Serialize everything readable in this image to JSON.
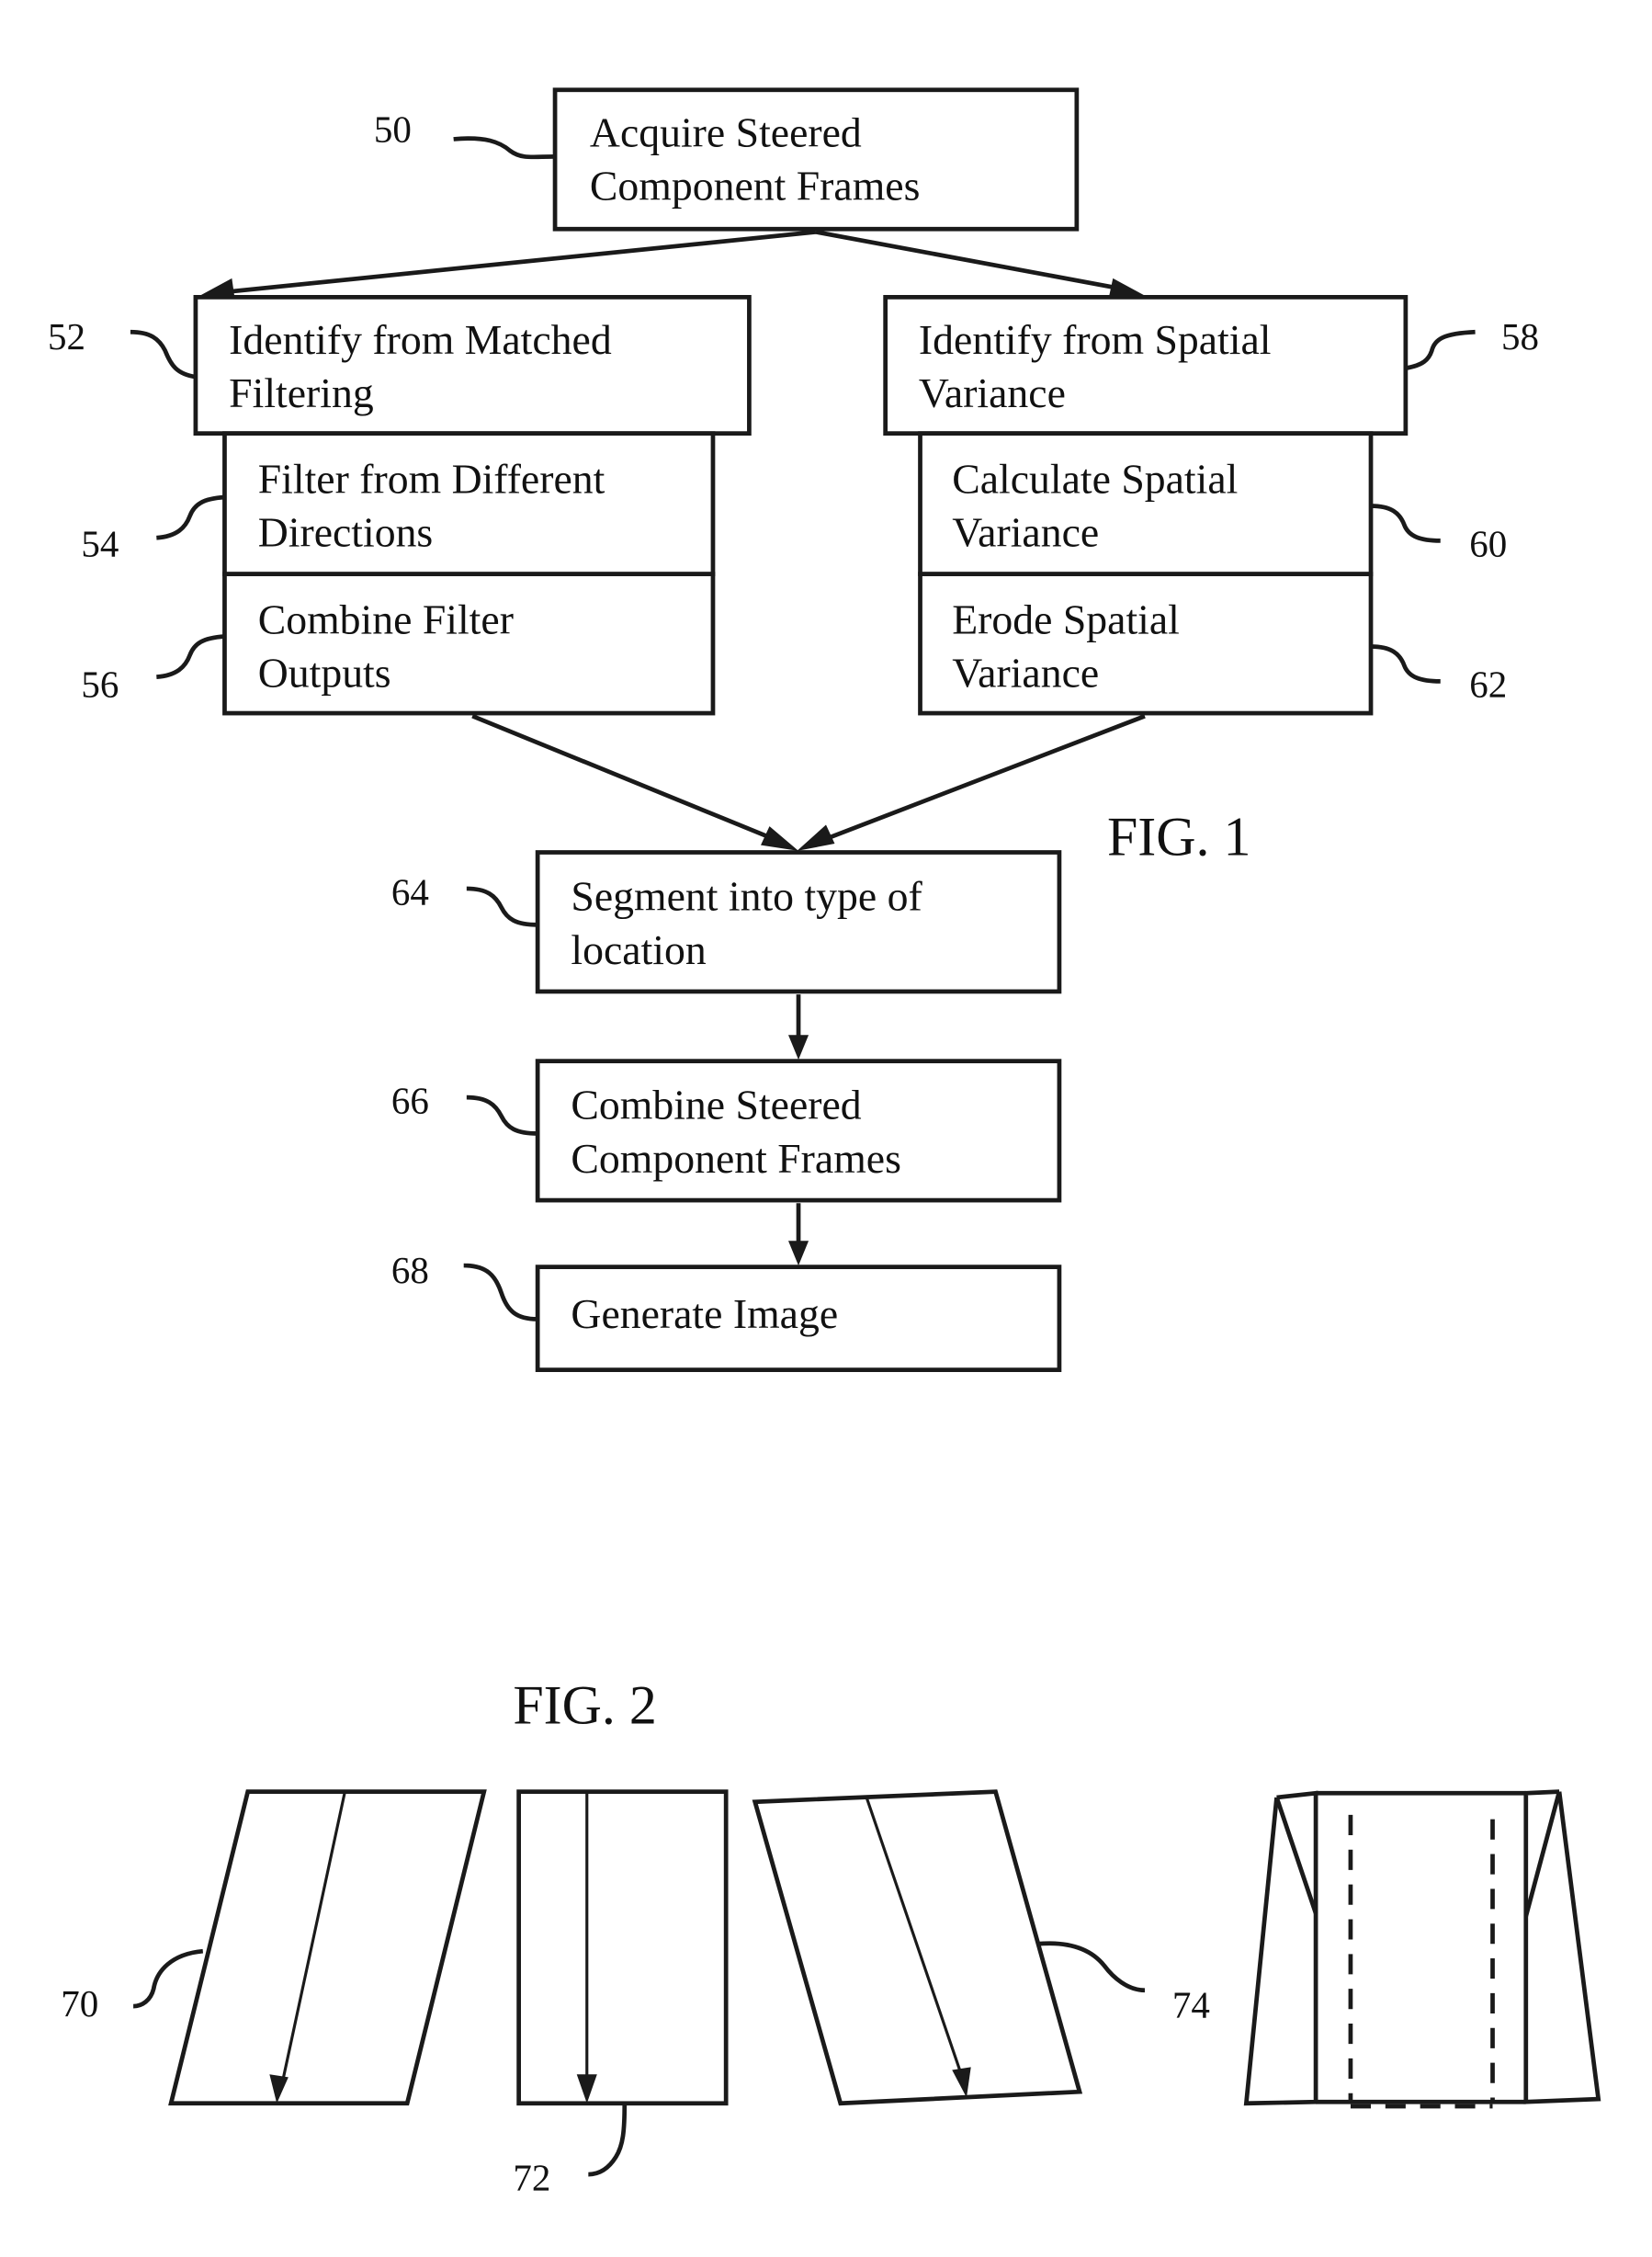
{
  "figure1": {
    "label": "FIG. 1",
    "steps": [
      {
        "ref": "50",
        "lines": [
          "Acquire Steered",
          "Component Frames"
        ]
      },
      {
        "ref": "52",
        "lines": [
          "Identify from Matched",
          "Filtering"
        ]
      },
      {
        "ref": "54",
        "lines": [
          "Filter from Different",
          "Directions"
        ]
      },
      {
        "ref": "56",
        "lines": [
          "Combine Filter",
          "Outputs"
        ]
      },
      {
        "ref": "58",
        "lines": [
          "Identify from Spatial",
          "Variance"
        ]
      },
      {
        "ref": "60",
        "lines": [
          "Calculate Spatial",
          "Variance"
        ]
      },
      {
        "ref": "62",
        "lines": [
          "Erode Spatial",
          "Variance"
        ]
      },
      {
        "ref": "64",
        "lines": [
          "Segment into type of",
          "location"
        ]
      },
      {
        "ref": "66",
        "lines": [
          "Combine Steered",
          "Component Frames"
        ]
      },
      {
        "ref": "68",
        "lines": [
          "Generate Image"
        ]
      }
    ]
  },
  "figure2": {
    "label": "FIG. 2",
    "refs": [
      "70",
      "72",
      "74"
    ]
  }
}
